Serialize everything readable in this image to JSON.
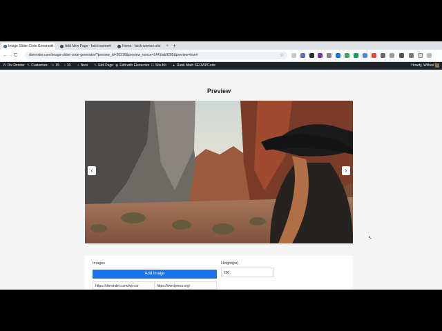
{
  "browser": {
    "tabs": [
      {
        "title": "Image Slider Code Generator",
        "active": true
      },
      {
        "title": "Add New Page - brick-women",
        "active": false
      },
      {
        "title": "Home - brick-women-site",
        "active": false
      }
    ],
    "new_tab_label": "+",
    "back_label": "←",
    "forward_label": "→",
    "reload_label": "C",
    "url": "divrender.com/image-slider-code-generator/?preview_id=20216&preview_nonce=1441fab9285&preview=true#",
    "bookmark_label": "☆"
  },
  "wp_admin_bar": {
    "items": [
      {
        "icon": "W",
        "label": "Div Render"
      },
      {
        "icon": "✎",
        "label": "Customize"
      },
      {
        "icon": "↻",
        "label": "15"
      },
      {
        "icon": "▪",
        "label": "10"
      },
      {
        "icon": "+",
        "label": "New"
      },
      {
        "icon": "✎",
        "label": "Edit Page"
      },
      {
        "icon": "◉",
        "label": "Edit with Elementor"
      },
      {
        "icon": "G",
        "label": "Site Kit"
      },
      {
        "icon": "▲",
        "label": "Rank Math SEO"
      },
      {
        "icon": "",
        "label": "WPCode"
      }
    ],
    "howdy": "Howdy, Wilfred"
  },
  "preview": {
    "title": "Preview",
    "prev_label": "‹",
    "next_label": "›"
  },
  "form": {
    "images_label": "Images",
    "add_image_label": "Add Image",
    "url_value_1": "https://divrender.com/wp-cor",
    "url_value_2": "https://wordpress.org/",
    "height_label": "Height(px)",
    "height_value": "600"
  },
  "scroll_top_label": "⌃",
  "colors": {
    "wp_bar": "#1d2327",
    "accent_button": "#1a73e8"
  }
}
